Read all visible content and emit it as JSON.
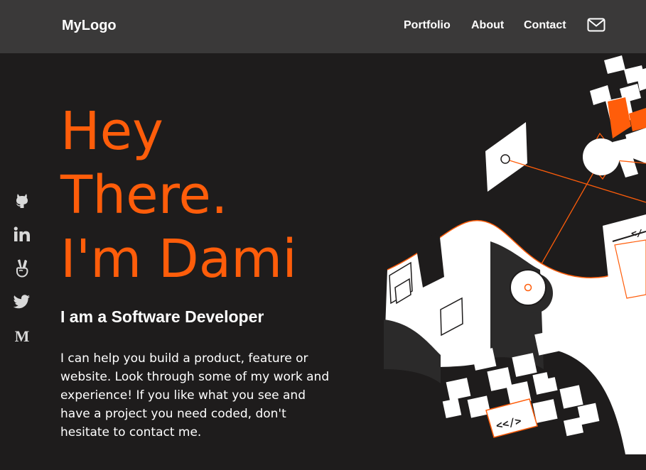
{
  "nav": {
    "logo": "MyLogo",
    "links": [
      "Portfolio",
      "About",
      "Contact"
    ],
    "mail_icon": "envelope-icon"
  },
  "social": {
    "icons": [
      "github-icon",
      "linkedin-icon",
      "angellist-icon",
      "twitter-icon",
      "medium-icon"
    ],
    "medium_glyph": "M"
  },
  "hero": {
    "title_lines": [
      "Hey",
      "There.",
      "I'm Dami"
    ],
    "subtitle": "I am a Software Developer",
    "bio": "I can help you build a product, feature or website. Look through some of my work and experience! If you like what you see and have a project you need coded, don't hesitate to contact me."
  },
  "illustration": {
    "code_tags": [
      "<</>",
      "</"
    ]
  },
  "colors": {
    "accent": "#ff5d0a",
    "background": "#1e1c1c",
    "navbar": "#3a3939",
    "text": "#ffffff"
  }
}
